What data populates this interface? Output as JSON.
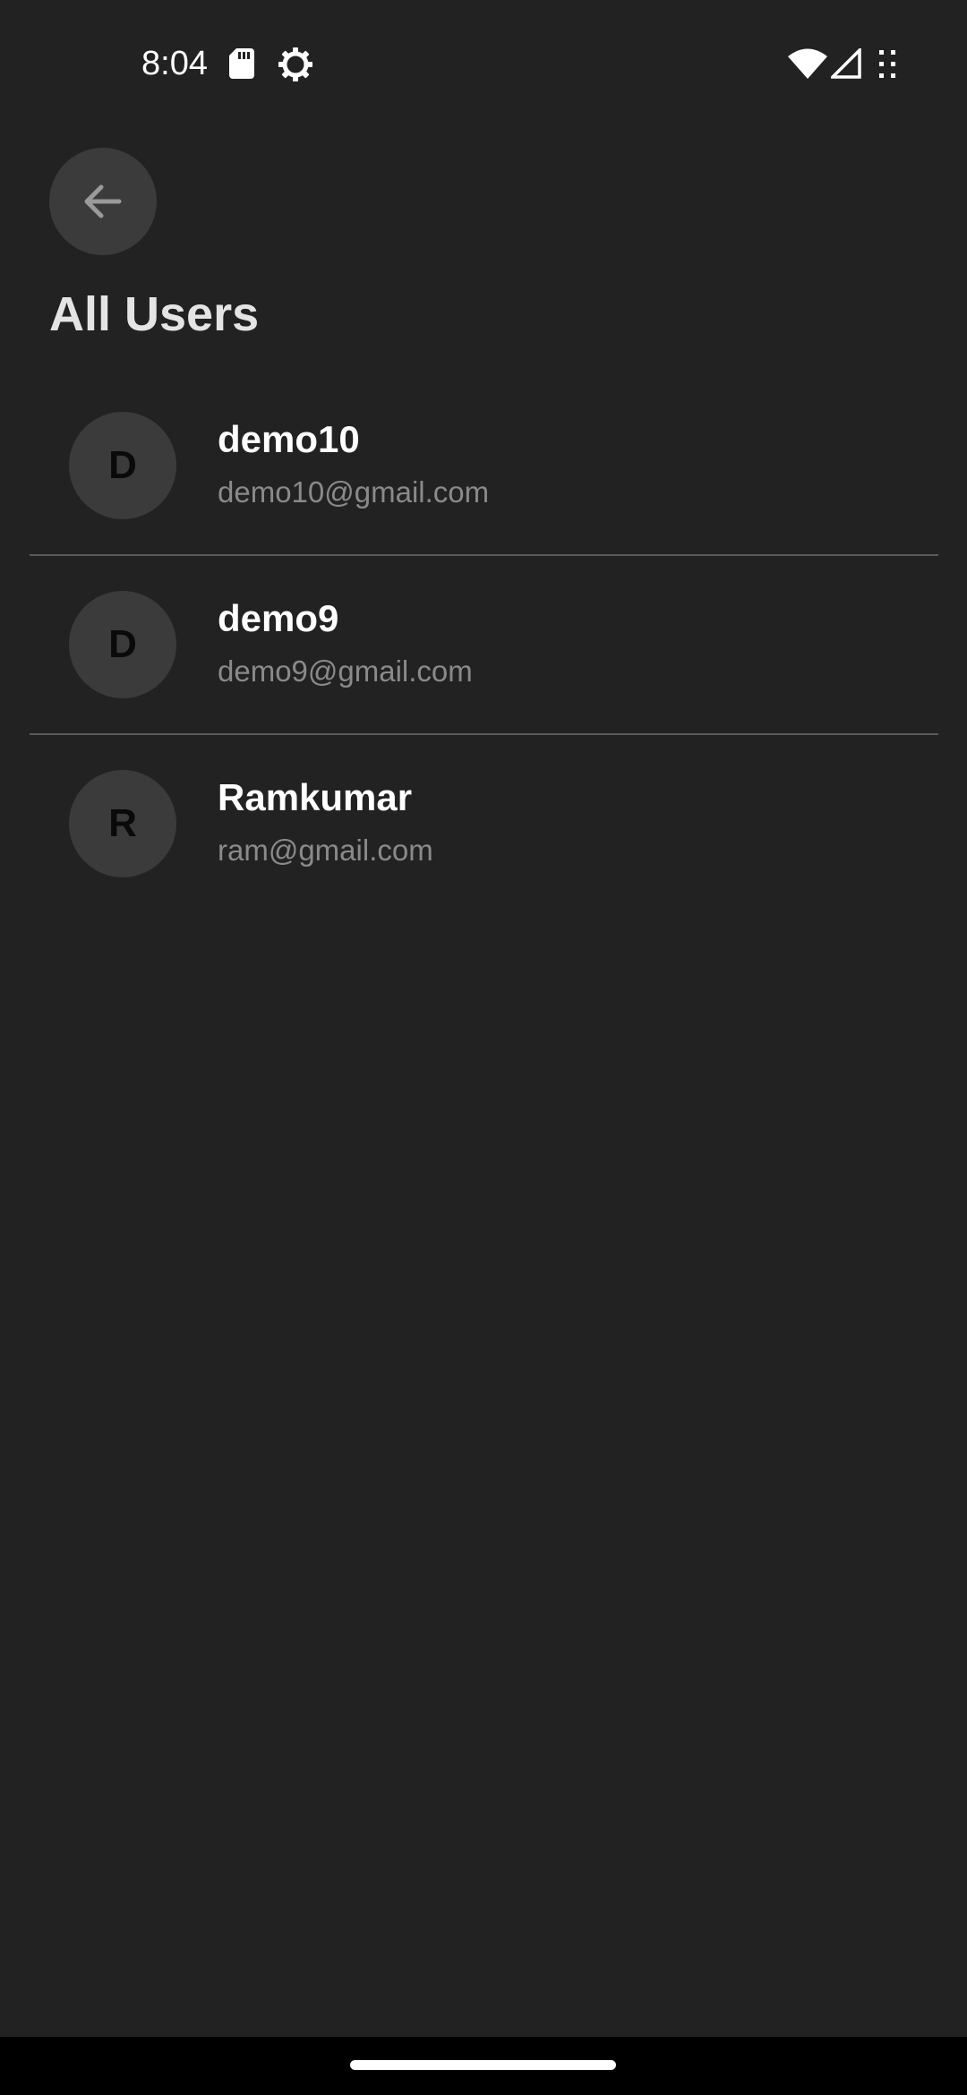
{
  "status_bar": {
    "time": "8:04",
    "left_icons": [
      "sd-card-icon",
      "settings-gear-icon"
    ],
    "right_icons": [
      "wifi-icon",
      "cell-signal-icon",
      "more-dots-icon"
    ]
  },
  "header": {
    "back_icon": "arrow-left-icon",
    "title": "All Users"
  },
  "users": [
    {
      "initial": "D",
      "name": "demo10",
      "email": "demo10@gmail.com"
    },
    {
      "initial": "D",
      "name": "demo9",
      "email": "demo9@gmail.com"
    },
    {
      "initial": "R",
      "name": "Ramkumar",
      "email": "ram@gmail.com"
    }
  ],
  "colors": {
    "background": "#222222",
    "avatar_bg": "#3b3b3b",
    "email_text": "#8a8a8a",
    "divider": "#5a5a5a"
  }
}
